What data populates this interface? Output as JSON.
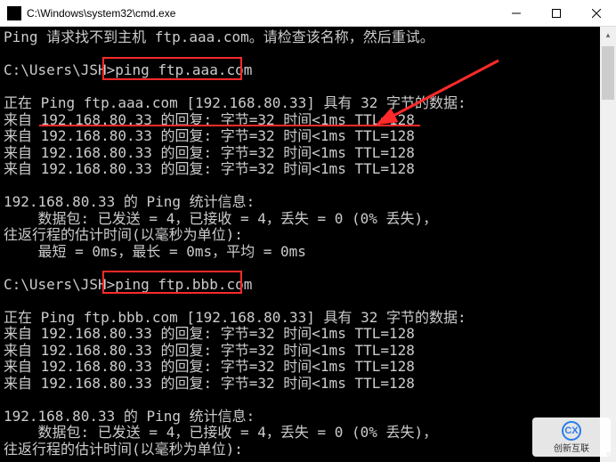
{
  "titlebar": {
    "icon_label": "C:\\",
    "title": "C:\\Windows\\system32\\cmd.exe"
  },
  "terminal": {
    "lines": [
      "Ping 请求找不到主机 ftp.aaa.com。请检查该名称，然后重试。",
      "",
      "C:\\Users\\JSH>ping ftp.aaa.com",
      "",
      "正在 Ping ftp.aaa.com [192.168.80.33] 具有 32 字节的数据:",
      "来自 192.168.80.33 的回复: 字节=32 时间<1ms TTL=128",
      "来自 192.168.80.33 的回复: 字节=32 时间<1ms TTL=128",
      "来自 192.168.80.33 的回复: 字节=32 时间<1ms TTL=128",
      "来自 192.168.80.33 的回复: 字节=32 时间<1ms TTL=128",
      "",
      "192.168.80.33 的 Ping 统计信息:",
      "    数据包: 已发送 = 4，已接收 = 4，丢失 = 0 (0% 丢失)，",
      "往返行程的估计时间(以毫秒为单位):",
      "    最短 = 0ms，最长 = 0ms，平均 = 0ms",
      "",
      "C:\\Users\\JSH>ping ftp.bbb.com",
      "",
      "正在 Ping ftp.bbb.com [192.168.80.33] 具有 32 字节的数据:",
      "来自 192.168.80.33 的回复: 字节=32 时间<1ms TTL=128",
      "来自 192.168.80.33 的回复: 字节=32 时间<1ms TTL=128",
      "来自 192.168.80.33 的回复: 字节=32 时间<1ms TTL=128",
      "来自 192.168.80.33 的回复: 字节=32 时间<1ms TTL=128",
      "",
      "192.168.80.33 的 Ping 统计信息:",
      "    数据包: 已发送 = 4，已接收 = 4，丢失 = 0 (0% 丢失)，",
      "往返行程的估计时间(以毫秒为单位):"
    ]
  },
  "annotations": {
    "box1_label": "highlight-ping-aaa",
    "box2_label": "highlight-ping-bbb",
    "underline_label": "highlight-reply-line",
    "arrow_color": "#ff2a2a"
  },
  "watermark": {
    "text": "创新互联",
    "icon_text": "CX"
  }
}
